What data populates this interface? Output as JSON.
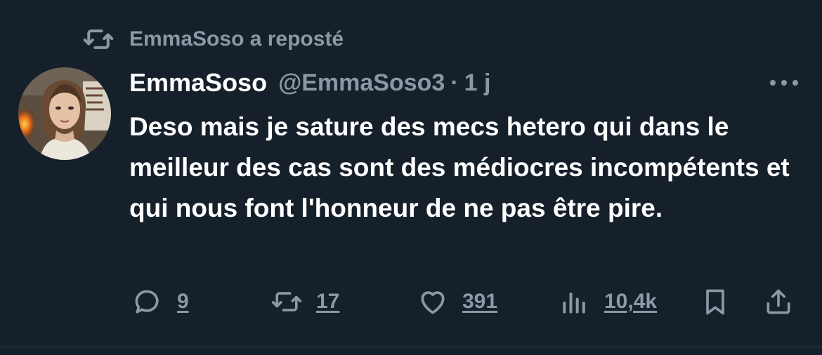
{
  "repost": {
    "label": "EmmaSoso a reposté",
    "icon": "repost-icon"
  },
  "tweet": {
    "author": {
      "display_name": "EmmaSoso",
      "handle": "@EmmaSoso3",
      "avatar": "avatar-photo"
    },
    "separator": "·",
    "time": "1 j",
    "more_icon": "more-horizontal-icon",
    "text": "Deso mais je sature des mecs hetero qui dans le meilleur des cas sont des médiocres incompétents et qui nous font l'honneur de ne pas être pire."
  },
  "actions": {
    "replies": "9",
    "reposts": "17",
    "likes": "391",
    "views": "10,4k",
    "icons": [
      "reply-icon",
      "repost-icon",
      "like-icon",
      "views-icon",
      "bookmark-icon",
      "share-icon"
    ]
  },
  "colors": {
    "background": "#15202b",
    "text_primary": "#ffffff",
    "text_secondary": "#8b98a5"
  }
}
